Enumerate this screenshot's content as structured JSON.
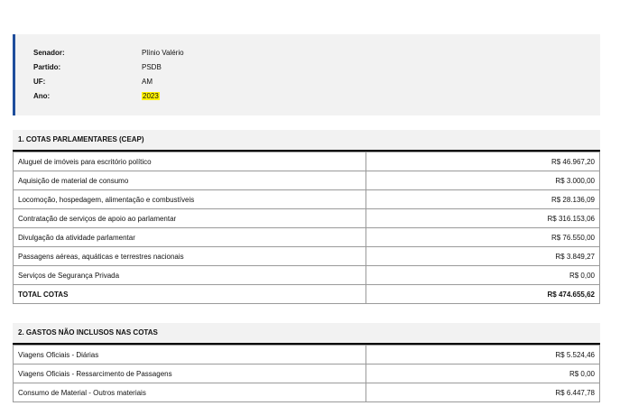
{
  "info": {
    "senador_label": "Senador:",
    "senador_value": "Plínio Valério",
    "partido_label": "Partido:",
    "partido_value": "PSDB",
    "uf_label": "UF:",
    "uf_value": "AM",
    "ano_label": "Ano:",
    "ano_value": "2023",
    "accent_color": "#1f4e9c",
    "highlight_color": "#fff200"
  },
  "section1": {
    "title": "1. COTAS PARLAMENTARES (CEAP)",
    "rows": [
      {
        "label": "Aluguel de imóveis para escritório político",
        "value": "R$ 46.967,20"
      },
      {
        "label": "Aquisição de material de consumo",
        "value": "R$ 3.000,00"
      },
      {
        "label": "Locomoção, hospedagem, alimentação e combustíveis",
        "value": "R$ 28.136,09"
      },
      {
        "label": "Contratação de serviços de apoio ao parlamentar",
        "value": "R$ 316.153,06"
      },
      {
        "label": "Divulgação da atividade parlamentar",
        "value": "R$ 76.550,00"
      },
      {
        "label": "Passagens aéreas, aquáticas e terrestres nacionais",
        "value": "R$ 3.849,27"
      },
      {
        "label": "Serviços de Segurança Privada",
        "value": "R$ 0,00"
      }
    ],
    "total_label": "TOTAL COTAS",
    "total_value": "R$ 474.655,62"
  },
  "section2": {
    "title": "2. GASTOS NÃO INCLUSOS NAS COTAS",
    "rows": [
      {
        "label": "Viagens Oficiais - Diárias",
        "value": "R$ 5.524,46"
      },
      {
        "label": "Viagens Oficiais - Ressarcimento de Passagens",
        "value": "R$ 0,00"
      },
      {
        "label": "Consumo de Material - Outros materiais",
        "value": "R$ 6.447,78"
      }
    ]
  }
}
